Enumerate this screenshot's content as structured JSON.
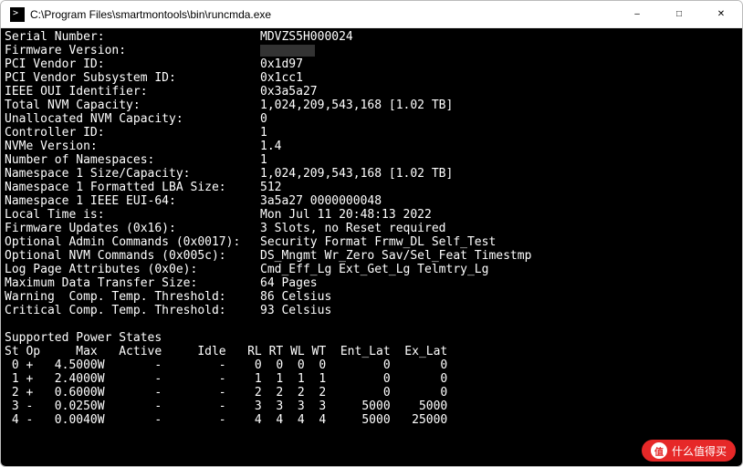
{
  "window": {
    "title": "C:\\Program Files\\smartmontools\\bin\\runcmda.exe"
  },
  "info": [
    {
      "label": "Serial Number:",
      "value": "MDVZS5H000024"
    },
    {
      "label": "Firmware Version:",
      "value": ""
    },
    {
      "label": "PCI Vendor ID:",
      "value": "0x1d97"
    },
    {
      "label": "PCI Vendor Subsystem ID:",
      "value": "0x1cc1"
    },
    {
      "label": "IEEE OUI Identifier:",
      "value": "0x3a5a27"
    },
    {
      "label": "Total NVM Capacity:",
      "value": "1,024,209,543,168 [1.02 TB]"
    },
    {
      "label": "Unallocated NVM Capacity:",
      "value": "0"
    },
    {
      "label": "Controller ID:",
      "value": "1"
    },
    {
      "label": "NVMe Version:",
      "value": "1.4"
    },
    {
      "label": "Number of Namespaces:",
      "value": "1"
    },
    {
      "label": "Namespace 1 Size/Capacity:",
      "value": "1,024,209,543,168 [1.02 TB]"
    },
    {
      "label": "Namespace 1 Formatted LBA Size:",
      "value": "512"
    },
    {
      "label": "Namespace 1 IEEE EUI-64:",
      "value": "3a5a27 0000000048"
    },
    {
      "label": "Local Time is:",
      "value": "Mon Jul 11 20:48:13 2022"
    },
    {
      "label": "Firmware Updates (0x16):",
      "value": "3 Slots, no Reset required"
    },
    {
      "label": "Optional Admin Commands (0x0017):",
      "value": "Security Format Frmw_DL Self_Test"
    },
    {
      "label": "Optional NVM Commands (0x005c):",
      "value": "DS_Mngmt Wr_Zero Sav/Sel_Feat Timestmp"
    },
    {
      "label": "Log Page Attributes (0x0e):",
      "value": "Cmd_Eff_Lg Ext_Get_Lg Telmtry_Lg"
    },
    {
      "label": "Maximum Data Transfer Size:",
      "value": "64 Pages"
    },
    {
      "label": "Warning  Comp. Temp. Threshold:",
      "value": "86 Celsius"
    },
    {
      "label": "Critical Comp. Temp. Threshold:",
      "value": "93 Celsius"
    }
  ],
  "power_header": "Supported Power States",
  "power_cols": "St Op     Max   Active     Idle   RL RT WL WT  Ent_Lat  Ex_Lat",
  "power_rows": [
    " 0 +   4.5000W       -        -    0  0  0  0        0       0",
    " 1 +   2.4000W       -        -    1  1  1  1        0       0",
    " 2 +   0.6000W       -        -    2  2  2  2        0       0",
    " 3 -   0.0250W       -        -    3  3  3  3     5000    5000",
    " 4 -   0.0040W       -        -    4  4  4  4     5000   25000"
  ],
  "watermark": {
    "badge": "值",
    "text": "什么值得买"
  }
}
